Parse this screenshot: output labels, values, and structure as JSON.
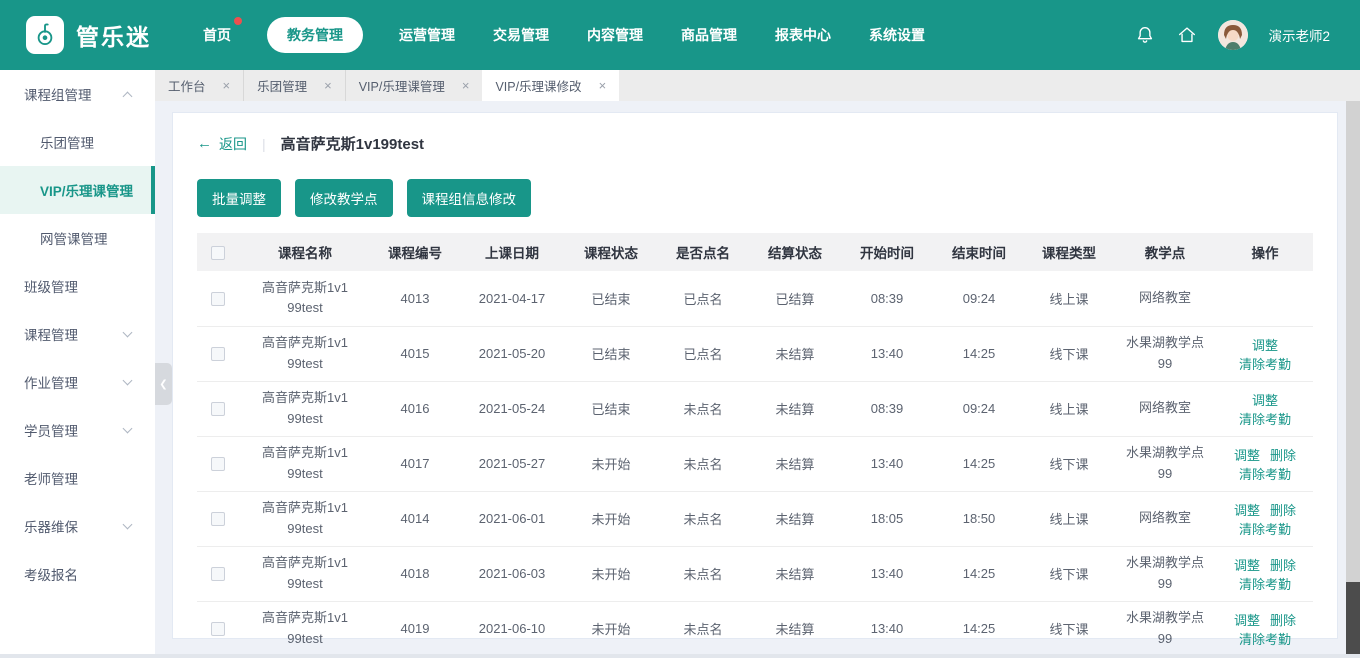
{
  "colors": {
    "accent": "#189689",
    "badge": "#ee4f4f"
  },
  "icons": {
    "close": "×",
    "back": "←",
    "divider": "|",
    "collapse": "❮"
  },
  "brand": {
    "name": "管乐迷"
  },
  "header": {
    "nav": [
      {
        "label": "首页",
        "badge": true
      },
      {
        "label": "教务管理",
        "active": true
      },
      {
        "label": "运营管理"
      },
      {
        "label": "交易管理"
      },
      {
        "label": "内容管理"
      },
      {
        "label": "商品管理"
      },
      {
        "label": "报表中心"
      },
      {
        "label": "系统设置"
      }
    ],
    "user": {
      "name": "演示老师2"
    }
  },
  "sidebar": {
    "items": [
      {
        "label": "课程组管理",
        "level": "top",
        "chevron": "up"
      },
      {
        "label": "乐团管理",
        "level": "sub"
      },
      {
        "label": "VIP/乐理课管理",
        "level": "sub",
        "active": true
      },
      {
        "label": "网管课管理",
        "level": "sub"
      },
      {
        "label": "班级管理",
        "level": "top"
      },
      {
        "label": "课程管理",
        "level": "top",
        "chevron": "down"
      },
      {
        "label": "作业管理",
        "level": "top",
        "chevron": "down"
      },
      {
        "label": "学员管理",
        "level": "top",
        "chevron": "down"
      },
      {
        "label": "老师管理",
        "level": "top"
      },
      {
        "label": "乐器维保",
        "level": "top",
        "chevron": "down"
      },
      {
        "label": "考级报名",
        "level": "top"
      }
    ]
  },
  "tabs": [
    {
      "label": "工作台"
    },
    {
      "label": "乐团管理"
    },
    {
      "label": "VIP/乐理课管理"
    },
    {
      "label": "VIP/乐理课修改",
      "active": true
    }
  ],
  "page": {
    "back_label": "返回",
    "title": "高音萨克斯1v199test",
    "buttons": [
      "批量调整",
      "修改教学点",
      "课程组信息修改"
    ]
  },
  "table": {
    "headers": [
      "课程名称",
      "课程编号",
      "上课日期",
      "课程状态",
      "是否点名",
      "结算状态",
      "开始时间",
      "结束时间",
      "课程类型",
      "教学点",
      "操作"
    ],
    "rows": [
      {
        "name": "高音萨克斯1v199test",
        "code": "4013",
        "date": "2021-04-17",
        "status": "已结束",
        "rollcall": "已点名",
        "settlement": "已结算",
        "start": "08:39",
        "end": "09:24",
        "type": "线上课",
        "venue": "网络教室",
        "actions": []
      },
      {
        "name": "高音萨克斯1v199test",
        "code": "4015",
        "date": "2021-05-20",
        "status": "已结束",
        "rollcall": "已点名",
        "settlement": "未结算",
        "start": "13:40",
        "end": "14:25",
        "type": "线下课",
        "venue": "水果湖教学点99",
        "actions": [
          "调整",
          "清除考勤"
        ]
      },
      {
        "name": "高音萨克斯1v199test",
        "code": "4016",
        "date": "2021-05-24",
        "status": "已结束",
        "rollcall": "未点名",
        "settlement": "未结算",
        "start": "08:39",
        "end": "09:24",
        "type": "线上课",
        "venue": "网络教室",
        "actions": [
          "调整",
          "清除考勤"
        ]
      },
      {
        "name": "高音萨克斯1v199test",
        "code": "4017",
        "date": "2021-05-27",
        "status": "未开始",
        "rollcall": "未点名",
        "settlement": "未结算",
        "start": "13:40",
        "end": "14:25",
        "type": "线下课",
        "venue": "水果湖教学点99",
        "actions": [
          "调整",
          "删除",
          "清除考勤"
        ]
      },
      {
        "name": "高音萨克斯1v199test",
        "code": "4014",
        "date": "2021-06-01",
        "status": "未开始",
        "rollcall": "未点名",
        "settlement": "未结算",
        "start": "18:05",
        "end": "18:50",
        "type": "线上课",
        "venue": "网络教室",
        "actions": [
          "调整",
          "删除",
          "清除考勤"
        ]
      },
      {
        "name": "高音萨克斯1v199test",
        "code": "4018",
        "date": "2021-06-03",
        "status": "未开始",
        "rollcall": "未点名",
        "settlement": "未结算",
        "start": "13:40",
        "end": "14:25",
        "type": "线下课",
        "venue": "水果湖教学点99",
        "actions": [
          "调整",
          "删除",
          "清除考勤"
        ]
      },
      {
        "name": "高音萨克斯1v199test",
        "code": "4019",
        "date": "2021-06-10",
        "status": "未开始",
        "rollcall": "未点名",
        "settlement": "未结算",
        "start": "13:40",
        "end": "14:25",
        "type": "线下课",
        "venue": "水果湖教学点99",
        "actions": [
          "调整",
          "删除",
          "清除考勤"
        ]
      }
    ]
  }
}
